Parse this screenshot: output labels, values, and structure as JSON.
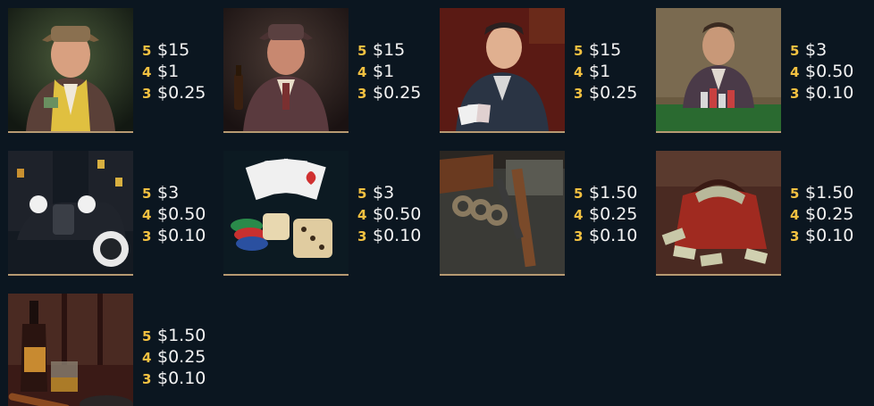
{
  "paytable": [
    {
      "symbol": "gangster-yellow-scarf",
      "pays": [
        {
          "count": "5",
          "value": "$15"
        },
        {
          "count": "4",
          "value": "$1"
        },
        {
          "count": "3",
          "value": "$0.25"
        }
      ]
    },
    {
      "symbol": "gangster-cigar-bottle",
      "pays": [
        {
          "count": "5",
          "value": "$15"
        },
        {
          "count": "4",
          "value": "$1"
        },
        {
          "count": "3",
          "value": "$0.25"
        }
      ]
    },
    {
      "symbol": "gangster-playing-cards",
      "pays": [
        {
          "count": "5",
          "value": "$15"
        },
        {
          "count": "4",
          "value": "$1"
        },
        {
          "count": "3",
          "value": "$0.25"
        }
      ]
    },
    {
      "symbol": "gangster-poker-chips",
      "pays": [
        {
          "count": "5",
          "value": "$3"
        },
        {
          "count": "4",
          "value": "$0.50"
        },
        {
          "count": "3",
          "value": "$0.10"
        }
      ]
    },
    {
      "symbol": "vintage-car",
      "pays": [
        {
          "count": "5",
          "value": "$3"
        },
        {
          "count": "4",
          "value": "$0.50"
        },
        {
          "count": "3",
          "value": "$0.10"
        }
      ]
    },
    {
      "symbol": "cards-dice-chips",
      "pays": [
        {
          "count": "5",
          "value": "$3"
        },
        {
          "count": "4",
          "value": "$0.50"
        },
        {
          "count": "3",
          "value": "$0.10"
        }
      ]
    },
    {
      "symbol": "brass-knuckles-gun",
      "pays": [
        {
          "count": "5",
          "value": "$1.50"
        },
        {
          "count": "4",
          "value": "$0.25"
        },
        {
          "count": "3",
          "value": "$0.10"
        }
      ]
    },
    {
      "symbol": "money-bag",
      "pays": [
        {
          "count": "5",
          "value": "$1.50"
        },
        {
          "count": "4",
          "value": "$0.25"
        },
        {
          "count": "3",
          "value": "$0.10"
        }
      ]
    },
    {
      "symbol": "whiskey-cigar",
      "pays": [
        {
          "count": "5",
          "value": "$1.50"
        },
        {
          "count": "4",
          "value": "$0.25"
        },
        {
          "count": "3",
          "value": "$0.10"
        }
      ]
    }
  ],
  "colors": {
    "background": "#0b1620",
    "count": "#f3c141",
    "value": "#f4f4f4",
    "underline": "#b79a72"
  }
}
